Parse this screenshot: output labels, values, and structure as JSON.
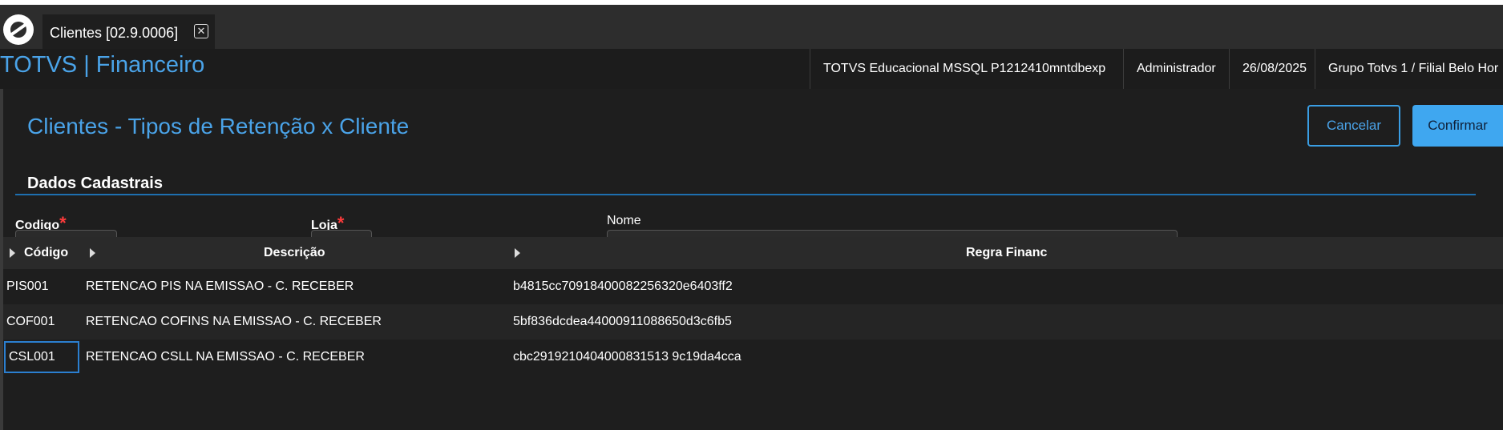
{
  "window": {
    "tab_label": "Clientes [02.9.0006]",
    "tab_close_glyph": "✕"
  },
  "header": {
    "brand": "TOTVS | Financeiro",
    "environment": "TOTVS Educacional MSSQL P1212410mntdbexp",
    "user": "Administrador",
    "date": "26/08/2025",
    "branch": "Grupo Totvs 1 / Filial Belo Hor"
  },
  "page": {
    "title": "Clientes - Tipos de Retenção x Cliente",
    "cancel_label": "Cancelar",
    "confirm_label": "Confirmar"
  },
  "form": {
    "section_title": "Dados Cadastrais",
    "fields": {
      "codigo_label": "Codigo",
      "loja_label": "Loja",
      "nome_label": "Nome",
      "required_mark": "*"
    }
  },
  "grid": {
    "columns": [
      "Código",
      "Descrição",
      "Regra Financ"
    ],
    "rows": [
      {
        "codigo": "PIS001",
        "descricao": "RETENCAO PIS NA EMISSAO - C. RECEBER",
        "regra": "b4815cc70918400082256320e6403ff2"
      },
      {
        "codigo": "COF001",
        "descricao": "RETENCAO COFINS NA EMISSAO - C. RECEBER",
        "regra": "5bf836dcdea44000911088650d3c6fb5"
      },
      {
        "codigo": "CSL001",
        "descricao": "RETENCAO CSLL NA EMISSAO - C. RECEBER",
        "regra": "cbc2919210404000831513 9c19da4cca"
      }
    ]
  },
  "icons": {
    "app_logo": "totvs-logo-icon",
    "tab_close": "close-icon",
    "column_arrow": "caret-right-icon"
  },
  "colors": {
    "accent": "#4aa3e8",
    "confirm_bg": "#3fa7f0",
    "required": "#ff3b3b"
  }
}
